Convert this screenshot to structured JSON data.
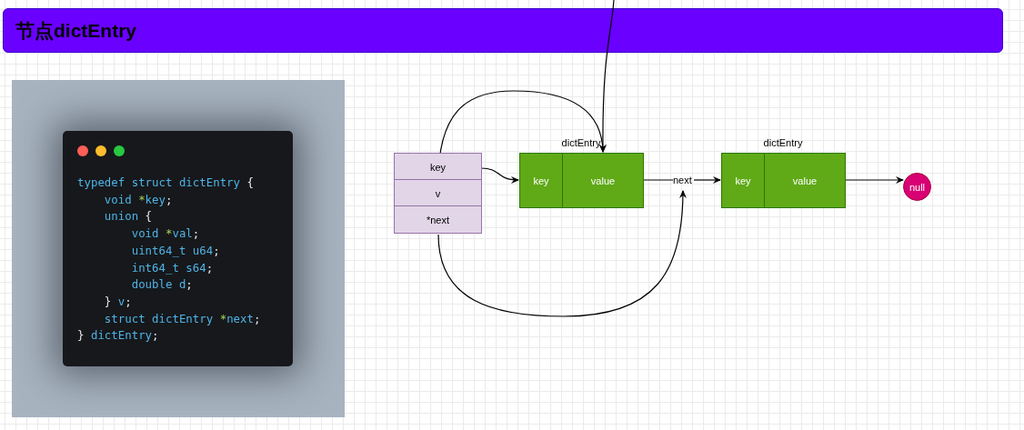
{
  "title": "节点dictEntry",
  "code_card": {
    "lines": [
      [
        {
          "text": "typedef struct dictEntry ",
          "kind": "code"
        },
        {
          "text": "{",
          "kind": "punct"
        }
      ],
      [
        {
          "text": "    void ",
          "kind": "code"
        },
        {
          "text": "*",
          "kind": "ptr"
        },
        {
          "text": "key",
          "kind": "code"
        },
        {
          "text": ";",
          "kind": "punct"
        }
      ],
      [
        {
          "text": "    union ",
          "kind": "code"
        },
        {
          "text": "{",
          "kind": "punct"
        }
      ],
      [
        {
          "text": "        void ",
          "kind": "code"
        },
        {
          "text": "*",
          "kind": "ptr"
        },
        {
          "text": "val",
          "kind": "code"
        },
        {
          "text": ";",
          "kind": "punct"
        }
      ],
      [
        {
          "text": "        uint64_t u64",
          "kind": "code"
        },
        {
          "text": ";",
          "kind": "punct"
        }
      ],
      [
        {
          "text": "        int64_t s64",
          "kind": "code"
        },
        {
          "text": ";",
          "kind": "punct"
        }
      ],
      [
        {
          "text": "        double d",
          "kind": "code"
        },
        {
          "text": ";",
          "kind": "punct"
        }
      ],
      [
        {
          "text": "    } ",
          "kind": "punct"
        },
        {
          "text": "v",
          "kind": "code"
        },
        {
          "text": ";",
          "kind": "punct"
        }
      ],
      [
        {
          "text": "    struct dictEntry ",
          "kind": "code"
        },
        {
          "text": "*",
          "kind": "ptr"
        },
        {
          "text": "next",
          "kind": "code"
        },
        {
          "text": ";",
          "kind": "punct"
        }
      ],
      [
        {
          "text": "} ",
          "kind": "punct"
        },
        {
          "text": "dictEntry",
          "kind": "code"
        },
        {
          "text": ";",
          "kind": "punct"
        }
      ]
    ]
  },
  "diagram": {
    "struct_fields": [
      "key",
      "v",
      "*next"
    ],
    "entries": [
      {
        "label": "dictEntry",
        "key": "key",
        "value": "value"
      },
      {
        "label": "dictEntry",
        "key": "key",
        "value": "value"
      }
    ],
    "next_label": "next",
    "null_label": "null"
  }
}
